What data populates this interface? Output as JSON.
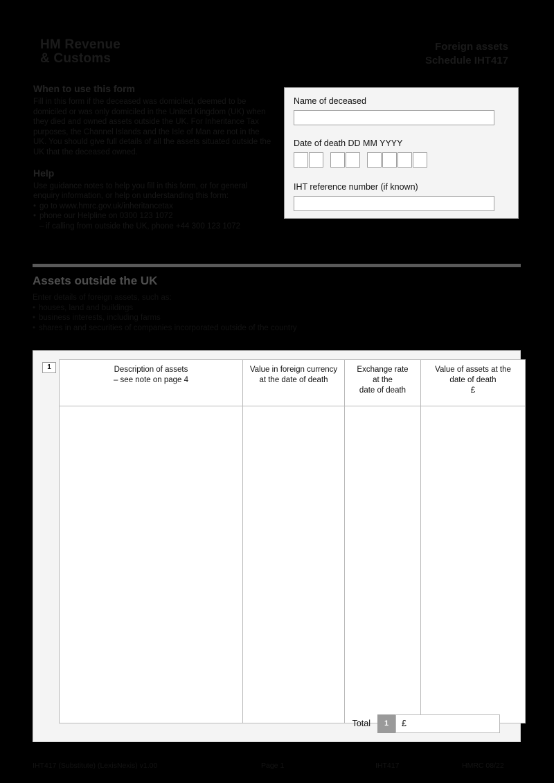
{
  "header": {
    "logo_line1": "HM Revenue",
    "logo_line2": "& Customs",
    "title_line1": "Foreign assets",
    "title_line2": "Schedule IHT417"
  },
  "intro": {
    "when_heading": "When to use this form",
    "when_body": "Fill in this form if the deceased was domiciled, deemed to be domiciled or was only domiciled in the United Kingdom (UK) when they died and owned assets outside the UK. For Inheritance Tax purposes, the Channel Islands and the Isle of Man are not in the UK. You should give full details of all the assets situated outside the UK that the deceased owned.",
    "help_heading": "Help",
    "help_body": "Use guidance notes to help you fill in this form, or for general enquiry information, or help on understanding this form:",
    "help_items": [
      "go to www.hmrc.gov.uk/inheritancetax",
      "phone our Helpline on 0300 123 1072"
    ],
    "help_subitem": "if calling from outside the UK, phone +44 300 123 1072"
  },
  "panel": {
    "name_label": "Name of deceased",
    "name_value": "",
    "name_placeholder": "",
    "dod_label": "Date of death DD MM YYYY",
    "dod_cells": [
      "",
      "",
      "",
      "",
      "",
      "",
      "",
      ""
    ],
    "ref_label": "IHT reference number (if known)",
    "ref_value": "",
    "ref_placeholder": ""
  },
  "assets": {
    "heading": "Assets outside the UK",
    "intro": "Enter details of foreign assets, such as:",
    "bullets": [
      "houses, land and buildings",
      "business interests, including farms",
      "shares in and securities of companies incorporated outside of the country"
    ]
  },
  "table": {
    "box_number": "1",
    "columns": [
      {
        "line1": "Description of assets",
        "line2": "– see note on page 4",
        "line3": ""
      },
      {
        "line1": "Value in foreign currency",
        "line2": "at the date of death",
        "line3": ""
      },
      {
        "line1": "Exchange rate",
        "line2": "at the",
        "line3": "date of death"
      },
      {
        "line1": "Value of assets at the",
        "line2": "date of death",
        "line3": "£"
      }
    ],
    "rows": [],
    "total_label": "Total",
    "total_box_number": "1",
    "total_currency": "£",
    "total_value": ""
  },
  "footer": {
    "left": "IHT417 (Substitute) (LexisNexis) v1.00",
    "page": "Page 1",
    "code": "IHT417",
    "hmrc": "HMRC 08/22"
  },
  "colors": {
    "background": "#000000",
    "panel_bg": "#f4f4f4",
    "field_bg": "#ffffff",
    "rule": "#595959",
    "heading_grey": "#4e4e4e",
    "box_grey": "#9a9a9a"
  }
}
